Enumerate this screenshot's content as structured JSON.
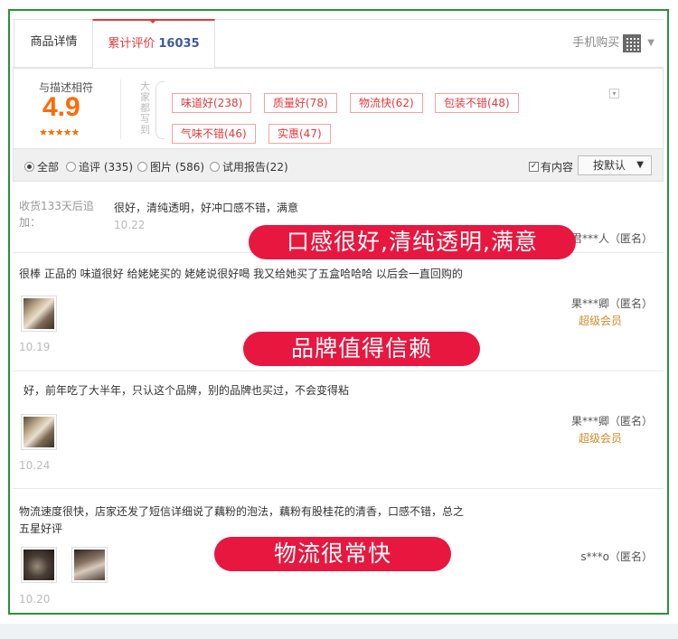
{
  "tabs": {
    "detail": "商品详情",
    "reviews": "累计评价",
    "reviews_count": "16035",
    "mobile_buy": "手机购买"
  },
  "summary": {
    "rate_label": "与描述相符",
    "rate_score": "4.9",
    "stars": "★★★★★",
    "everyone_label": "大家都写到",
    "tags": [
      "味道好(238)",
      "质量好(78)",
      "物流快(62)",
      "包装不错(48)",
      "气味不错(46)",
      "实惠(47)"
    ]
  },
  "filter": {
    "all": "全部",
    "append": "追评 (335)",
    "pictures": "图片 (586)",
    "trial": "试用报告(22)",
    "has_content": "有内容",
    "sort": "按默认"
  },
  "reviews": [
    {
      "prefix": "收货133天后追加：",
      "text": "很好，清纯透明，好冲口感不错，满意",
      "date": "10.22",
      "user": "君***人（匿名）",
      "level": ""
    },
    {
      "text": "很棒 正品的 味道很好 给姥姥买的 姥姥说很好喝 我又给她买了五盒哈哈哈 以后会一直回购的",
      "date": "10.19",
      "user": "果***卿（匿名）",
      "level": "超级会员"
    },
    {
      "text": "好，前年吃了大半年，只认这个品牌，别的品牌也买过，不会变得粘",
      "date": "10.24",
      "user": "果***卿（匿名）",
      "level": "超级会员"
    },
    {
      "text_line1": "物流速度很快，店家还发了短信详细说了藕粉的泡法，藕粉有股桂花的清香，口感不错，总之",
      "text_line2": "五星好评",
      "date": "10.20",
      "user": "s***o（匿名）",
      "level": ""
    }
  ],
  "banners": [
    "口感很好,清纯透明,满意",
    "品牌值得信赖",
    "物流很常快"
  ],
  "colors": {
    "accent": "#e4393c",
    "banner": "#e8173f",
    "frame": "#2d8f3f",
    "score": "#ff6a00"
  }
}
